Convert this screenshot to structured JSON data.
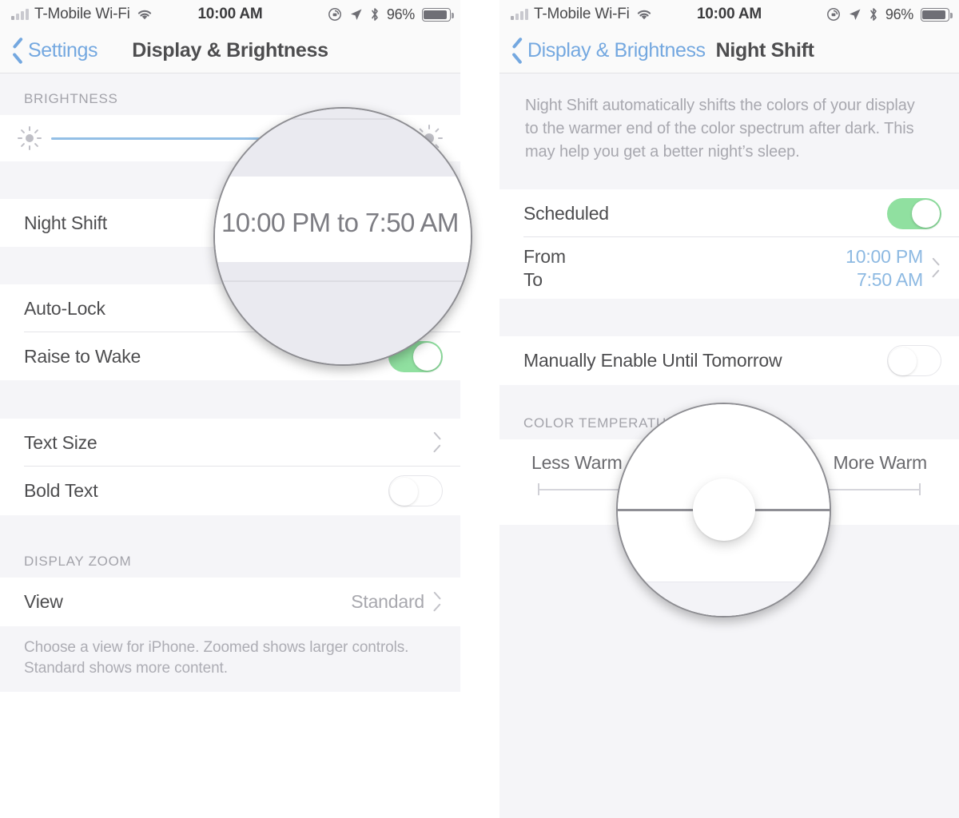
{
  "colors": {
    "tint_blue": "#74a8e0",
    "value_blue": "#8db9e2",
    "toggle_on_green": "#90e0a0",
    "group_bg": "#f5f5f8",
    "row_bg": "#ffffff"
  },
  "status_bar": {
    "carrier": "T-Mobile Wi-Fi",
    "time": "10:00 AM",
    "battery_percent": "96%",
    "icons": [
      "signal-bars-icon",
      "wifi-icon",
      "rotation-lock-icon",
      "location-arrow-icon",
      "bluetooth-icon",
      "battery-icon"
    ]
  },
  "left_panel": {
    "nav": {
      "back_label": "Settings",
      "title": "Display & Brightness"
    },
    "sections": [
      {
        "header": "BRIGHTNESS",
        "rows": [
          {
            "type": "slider",
            "name": "brightness-slider",
            "value_percent": 66,
            "left_icon": "sun-small-icon",
            "right_icon": "sun-large-icon"
          }
        ]
      },
      {
        "header": "",
        "rows": [
          {
            "type": "value",
            "label": "Night Shift",
            "value": "10:00 PM to 7:50 AM"
          }
        ]
      },
      {
        "header": "",
        "rows": [
          {
            "type": "value",
            "label": "Auto-Lock",
            "value": ""
          },
          {
            "type": "toggle",
            "label": "Raise to Wake",
            "toggle": "on"
          }
        ]
      },
      {
        "header": "",
        "rows": [
          {
            "type": "chevron",
            "label": "Text Size",
            "value": ""
          },
          {
            "type": "toggle",
            "label": "Bold Text",
            "toggle": "off"
          }
        ]
      },
      {
        "header": "DISPLAY ZOOM",
        "rows": [
          {
            "type": "chevron",
            "label": "View",
            "value": "Standard"
          }
        ],
        "footer": "Choose a view for iPhone. Zoomed shows larger controls. Standard shows more content."
      }
    ]
  },
  "right_panel": {
    "nav": {
      "back_label": "Display & Brightness",
      "title": "Night Shift"
    },
    "description": "Night Shift automatically shifts the colors of your display to the warmer end of the color spectrum after dark. This may help you get a better night’s sleep.",
    "rows": {
      "scheduled_label": "Scheduled",
      "scheduled_toggle": "on",
      "from_label": "From",
      "from_value": "10:00 PM",
      "to_label": "To",
      "to_value": "7:50 AM",
      "manual_label": "Manually Enable Until Tomorrow",
      "manual_toggle": "off"
    },
    "color_temperature": {
      "header": "COLOR TEMPERATURE",
      "left_label": "Less Warm",
      "right_label": "More Warm",
      "value_percent": 50
    }
  },
  "loupes": {
    "left": {
      "text": "10:00 PM to 7:50 AM",
      "magnifies": "night-shift-row-value"
    },
    "right": {
      "text": "",
      "magnifies": "color-temperature-slider-knob"
    }
  }
}
